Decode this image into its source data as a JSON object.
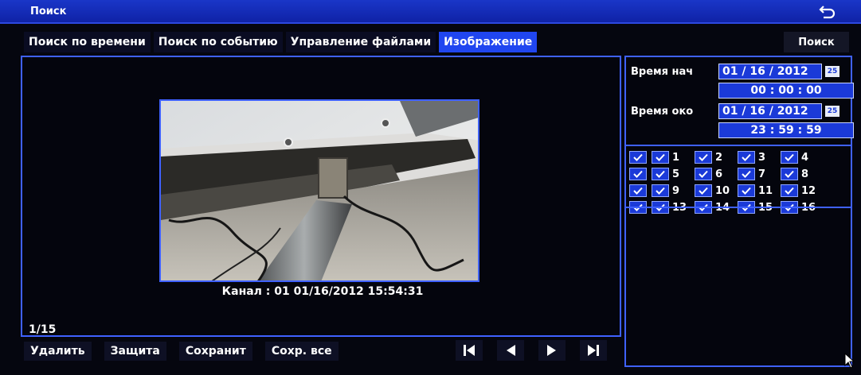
{
  "window": {
    "title": "Поиск",
    "back_icon": "return-arrow-icon"
  },
  "tabs": [
    {
      "label": "Поиск по времени",
      "active": false
    },
    {
      "label": "Поиск по событию",
      "active": false
    },
    {
      "label": "Управление файлами",
      "active": false
    },
    {
      "label": "Изображение",
      "active": true
    }
  ],
  "search_button": "Поиск",
  "preview": {
    "caption": "Канал : 01   01/16/2012 15:54:31",
    "counter": "1/15"
  },
  "toolbar": {
    "delete_label": "Удалить",
    "protect_label": "Защита",
    "save_label": "Сохранит",
    "save_all_label": "Сохр. все"
  },
  "playback_icons": [
    "first-icon",
    "previous-icon",
    "next-icon",
    "last-icon"
  ],
  "time_range": {
    "start_label": "Время нач",
    "start_date": "01 / 16 / 2012",
    "start_time": "00  :  00  :  00",
    "end_label": "Время око",
    "end_date": "01 / 16 / 2012",
    "end_time": "23  :  59  :  59",
    "calendar_icon_text": "25"
  },
  "channels": [
    [
      "1",
      "2",
      "3",
      "4"
    ],
    [
      "5",
      "6",
      "7",
      "8"
    ],
    [
      "9",
      "10",
      "11",
      "12"
    ],
    [
      "13",
      "14",
      "15",
      "16"
    ]
  ],
  "colors": {
    "accent": "#2046f0",
    "border": "#3f61ff",
    "background": "#05060f"
  }
}
